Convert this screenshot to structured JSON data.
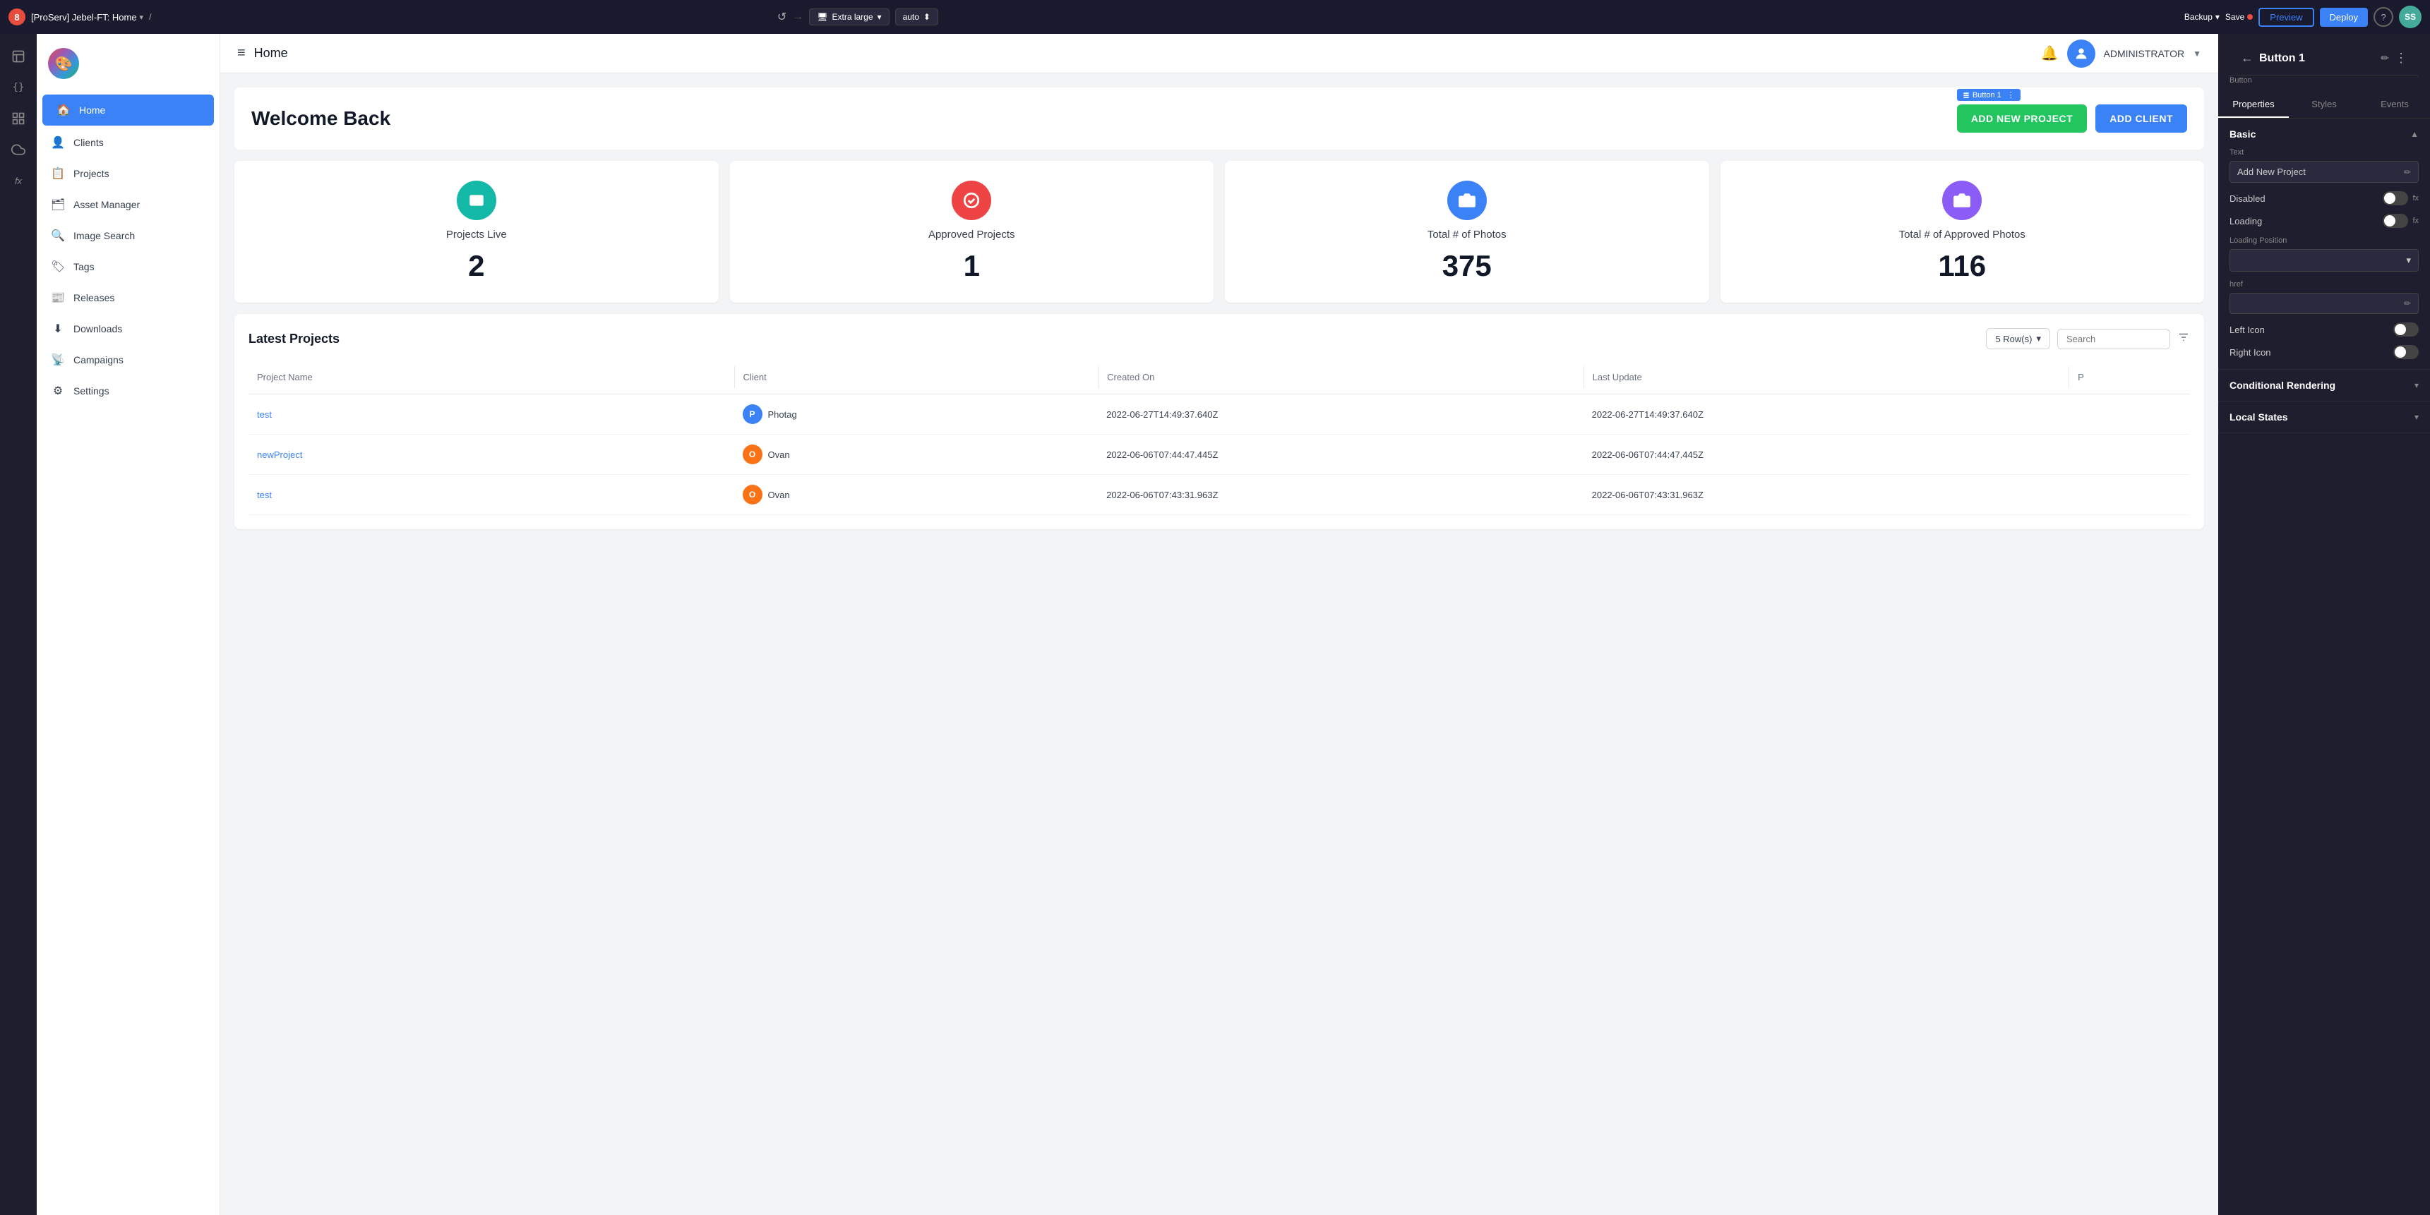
{
  "topbar": {
    "badge": "8",
    "title": "[ProServ] Jebel-FT: Home",
    "breadcrumb": "/",
    "undo_icon": "↺",
    "redo_icon": "→",
    "device_label": "Extra large",
    "auto_label": "auto",
    "backup_label": "Backup",
    "save_label": "Save",
    "preview_label": "Preview",
    "deploy_label": "Deploy",
    "help_label": "?",
    "avatar_label": "SS"
  },
  "icon_sidebar": {
    "icons": [
      {
        "name": "page-icon",
        "symbol": "📄"
      },
      {
        "name": "code-icon",
        "symbol": "{}"
      },
      {
        "name": "components-icon",
        "symbol": "⊞"
      },
      {
        "name": "cloud-icon",
        "symbol": "☁"
      },
      {
        "name": "function-icon",
        "symbol": "fx"
      }
    ]
  },
  "nav_sidebar": {
    "logo_symbol": "🎨",
    "items": [
      {
        "label": "Home",
        "icon": "🏠",
        "active": true
      },
      {
        "label": "Clients",
        "icon": "👤"
      },
      {
        "label": "Projects",
        "icon": "📋"
      },
      {
        "label": "Asset Manager",
        "icon": "🗂"
      },
      {
        "label": "Image Search",
        "icon": "🔍"
      },
      {
        "label": "Tags",
        "icon": "🏷"
      },
      {
        "label": "Releases",
        "icon": "📰"
      },
      {
        "label": "Downloads",
        "icon": "⬇"
      },
      {
        "label": "Campaigns",
        "icon": "📡"
      },
      {
        "label": "Settings",
        "icon": "⚙"
      }
    ]
  },
  "content_header": {
    "menu_icon": "≡",
    "page_title": "Home",
    "bell_icon": "🔔",
    "user_icon": "👤",
    "admin_label": "ADMINISTRATOR",
    "chevron": "▼"
  },
  "welcome": {
    "text": "Welcome Back",
    "btn_new_project": "ADD NEW PROJECT",
    "btn_add_client": "ADD CLIENT",
    "button_tag": "Button 1"
  },
  "stats": [
    {
      "label": "Projects Live",
      "value": "2",
      "icon": "📋",
      "color": "teal"
    },
    {
      "label": "Approved Projects",
      "value": "1",
      "icon": "✓",
      "color": "red"
    },
    {
      "label": "Total # of Photos",
      "value": "375",
      "icon": "📷",
      "color": "blue"
    },
    {
      "label": "Total # of Approved Photos",
      "value": "116",
      "icon": "📷",
      "color": "purple"
    }
  ],
  "table": {
    "title": "Latest Projects",
    "rows_label": "5 Row(s)",
    "search_placeholder": "Search",
    "columns": [
      "Project Name",
      "Client",
      "Created On",
      "Last Update",
      "P"
    ],
    "rows": [
      {
        "project_name": "test",
        "client_name": "Photag",
        "client_initial": "P",
        "client_color": "blue",
        "created_on": "2022-06-27T14:49:37.640Z",
        "last_update": "2022-06-27T14:49:37.640Z"
      },
      {
        "project_name": "newProject",
        "client_name": "Ovan",
        "client_initial": "O",
        "client_color": "orange",
        "created_on": "2022-06-06T07:44:47.445Z",
        "last_update": "2022-06-06T07:44:47.445Z"
      },
      {
        "project_name": "test",
        "client_name": "Ovan",
        "client_initial": "O",
        "client_color": "orange",
        "created_on": "2022-06-06T07:43:31.963Z",
        "last_update": "2022-06-06T07:43:31.963Z"
      }
    ]
  },
  "right_panel": {
    "back_icon": "←",
    "title": "Button 1",
    "subtitle": "Button",
    "edit_icon": "✏",
    "more_icon": "⋮",
    "tabs": [
      "Properties",
      "Styles",
      "Events"
    ],
    "active_tab": "Properties",
    "basic_section": {
      "title": "Basic",
      "text_label": "Text",
      "text_value": "Add New Project",
      "disabled_label": "Disabled",
      "loading_label": "Loading",
      "loading_position_label": "Loading Position",
      "href_label": "href",
      "left_icon_label": "Left Icon",
      "right_icon_label": "Right Icon"
    },
    "conditional_rendering": {
      "title": "Conditional Rendering"
    },
    "local_states": {
      "title": "Local States"
    }
  }
}
